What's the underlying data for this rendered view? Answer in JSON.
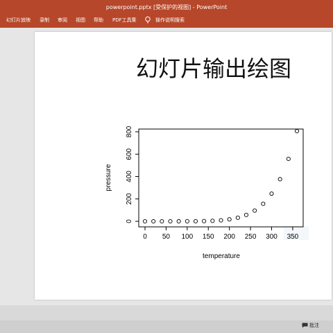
{
  "window": {
    "title": "powerpoint.pptx [受保护的视图] - PowerPoint"
  },
  "ribbon": {
    "tabs": [
      "幻灯片放映",
      "录制",
      "审阅",
      "视图",
      "帮助",
      "PDF工具集"
    ],
    "tell_me": "操作说明搜索"
  },
  "slide": {
    "title": "幻灯片输出绘图"
  },
  "status": {
    "comments_label": "批注"
  },
  "chart_data": {
    "type": "scatter",
    "xlabel": "temperature",
    "ylabel": "pressure",
    "xlim": [
      0,
      360
    ],
    "ylim": [
      0,
      806
    ],
    "xticks": [
      0,
      50,
      100,
      150,
      200,
      250,
      300,
      350
    ],
    "yticks": [
      0,
      200,
      400,
      600,
      800
    ],
    "x": [
      0,
      20,
      40,
      60,
      80,
      100,
      120,
      140,
      160,
      180,
      200,
      220,
      240,
      260,
      280,
      300,
      320,
      340,
      360
    ],
    "y": [
      0.0002,
      0.0012,
      0.006,
      0.03,
      0.09,
      0.27,
      0.75,
      1.85,
      4.2,
      8.8,
      17.3,
      32.1,
      57,
      96,
      157,
      247,
      376,
      558,
      806
    ],
    "marker": "open-circle",
    "marker_color": "#000000"
  }
}
